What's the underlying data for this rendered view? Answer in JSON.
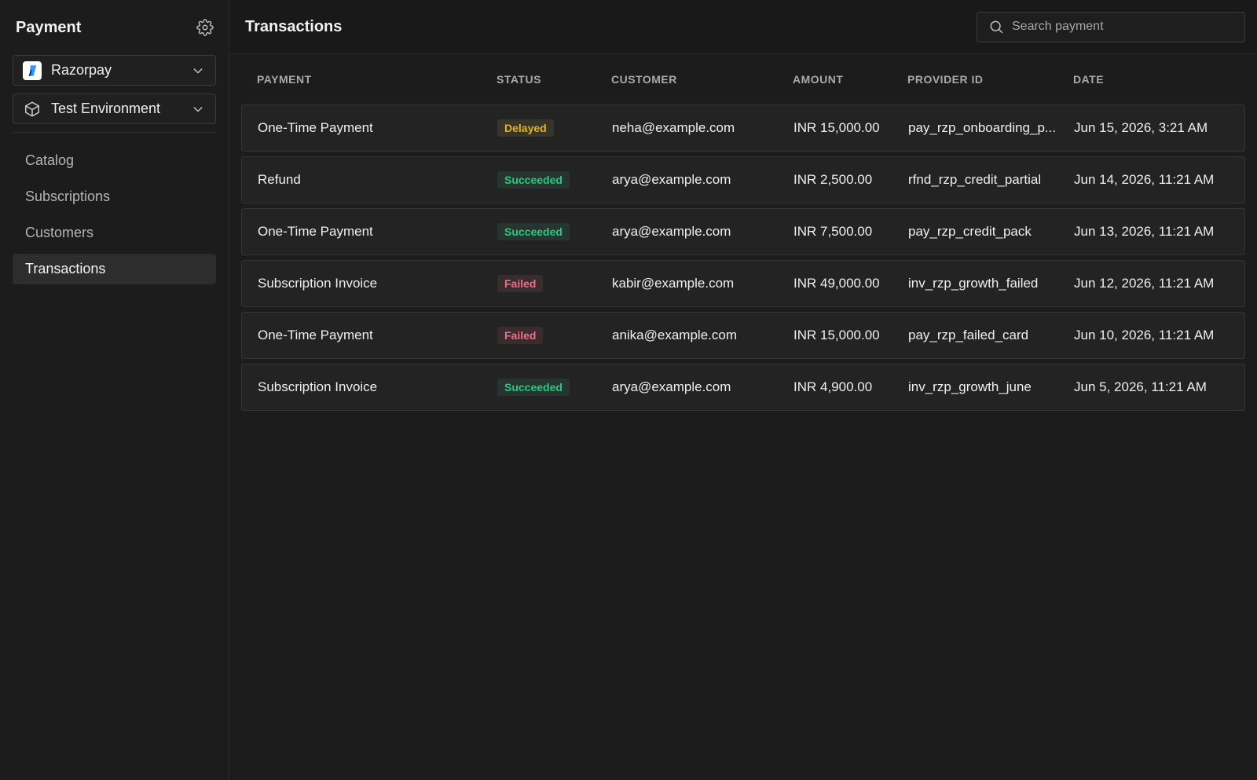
{
  "sidebar": {
    "title": "Payment",
    "provider_select": {
      "label": "Razorpay",
      "icon": "razorpay-logo"
    },
    "env_select": {
      "label": "Test Environment",
      "icon": "cube-icon"
    },
    "nav": [
      {
        "label": "Catalog",
        "active": false
      },
      {
        "label": "Subscriptions",
        "active": false
      },
      {
        "label": "Customers",
        "active": false
      },
      {
        "label": "Transactions",
        "active": true
      }
    ]
  },
  "header": {
    "title": "Transactions",
    "search_placeholder": "Search payment"
  },
  "table": {
    "columns": [
      "PAYMENT",
      "STATUS",
      "CUSTOMER",
      "AMOUNT",
      "PROVIDER ID",
      "DATE"
    ],
    "rows": [
      {
        "payment": "One-Time Payment",
        "status": "Delayed",
        "customer": "neha@example.com",
        "amount": "INR 15,000.00",
        "provider_id": "pay_rzp_onboarding_p...",
        "date": "Jun 15, 2026, 3:21 AM"
      },
      {
        "payment": "Refund",
        "status": "Succeeded",
        "customer": "arya@example.com",
        "amount": "INR 2,500.00",
        "provider_id": "rfnd_rzp_credit_partial",
        "date": "Jun 14, 2026, 11:21 AM"
      },
      {
        "payment": "One-Time Payment",
        "status": "Succeeded",
        "customer": "arya@example.com",
        "amount": "INR 7,500.00",
        "provider_id": "pay_rzp_credit_pack",
        "date": "Jun 13, 2026, 11:21 AM"
      },
      {
        "payment": "Subscription Invoice",
        "status": "Failed",
        "customer": "kabir@example.com",
        "amount": "INR 49,000.00",
        "provider_id": "inv_rzp_growth_failed",
        "date": "Jun 12, 2026, 11:21 AM"
      },
      {
        "payment": "One-Time Payment",
        "status": "Failed",
        "customer": "anika@example.com",
        "amount": "INR 15,000.00",
        "provider_id": "pay_rzp_failed_card",
        "date": "Jun 10, 2026, 11:21 AM"
      },
      {
        "payment": "Subscription Invoice",
        "status": "Succeeded",
        "customer": "arya@example.com",
        "amount": "INR 4,900.00",
        "provider_id": "inv_rzp_growth_june",
        "date": "Jun 5, 2026, 11:21 AM"
      }
    ]
  },
  "colors": {
    "background": "#1c1c1c",
    "delayed": "#e8b222",
    "succeeded": "#28c97f",
    "failed": "#ee6f86",
    "razorpay_blue": "#3395ff"
  }
}
